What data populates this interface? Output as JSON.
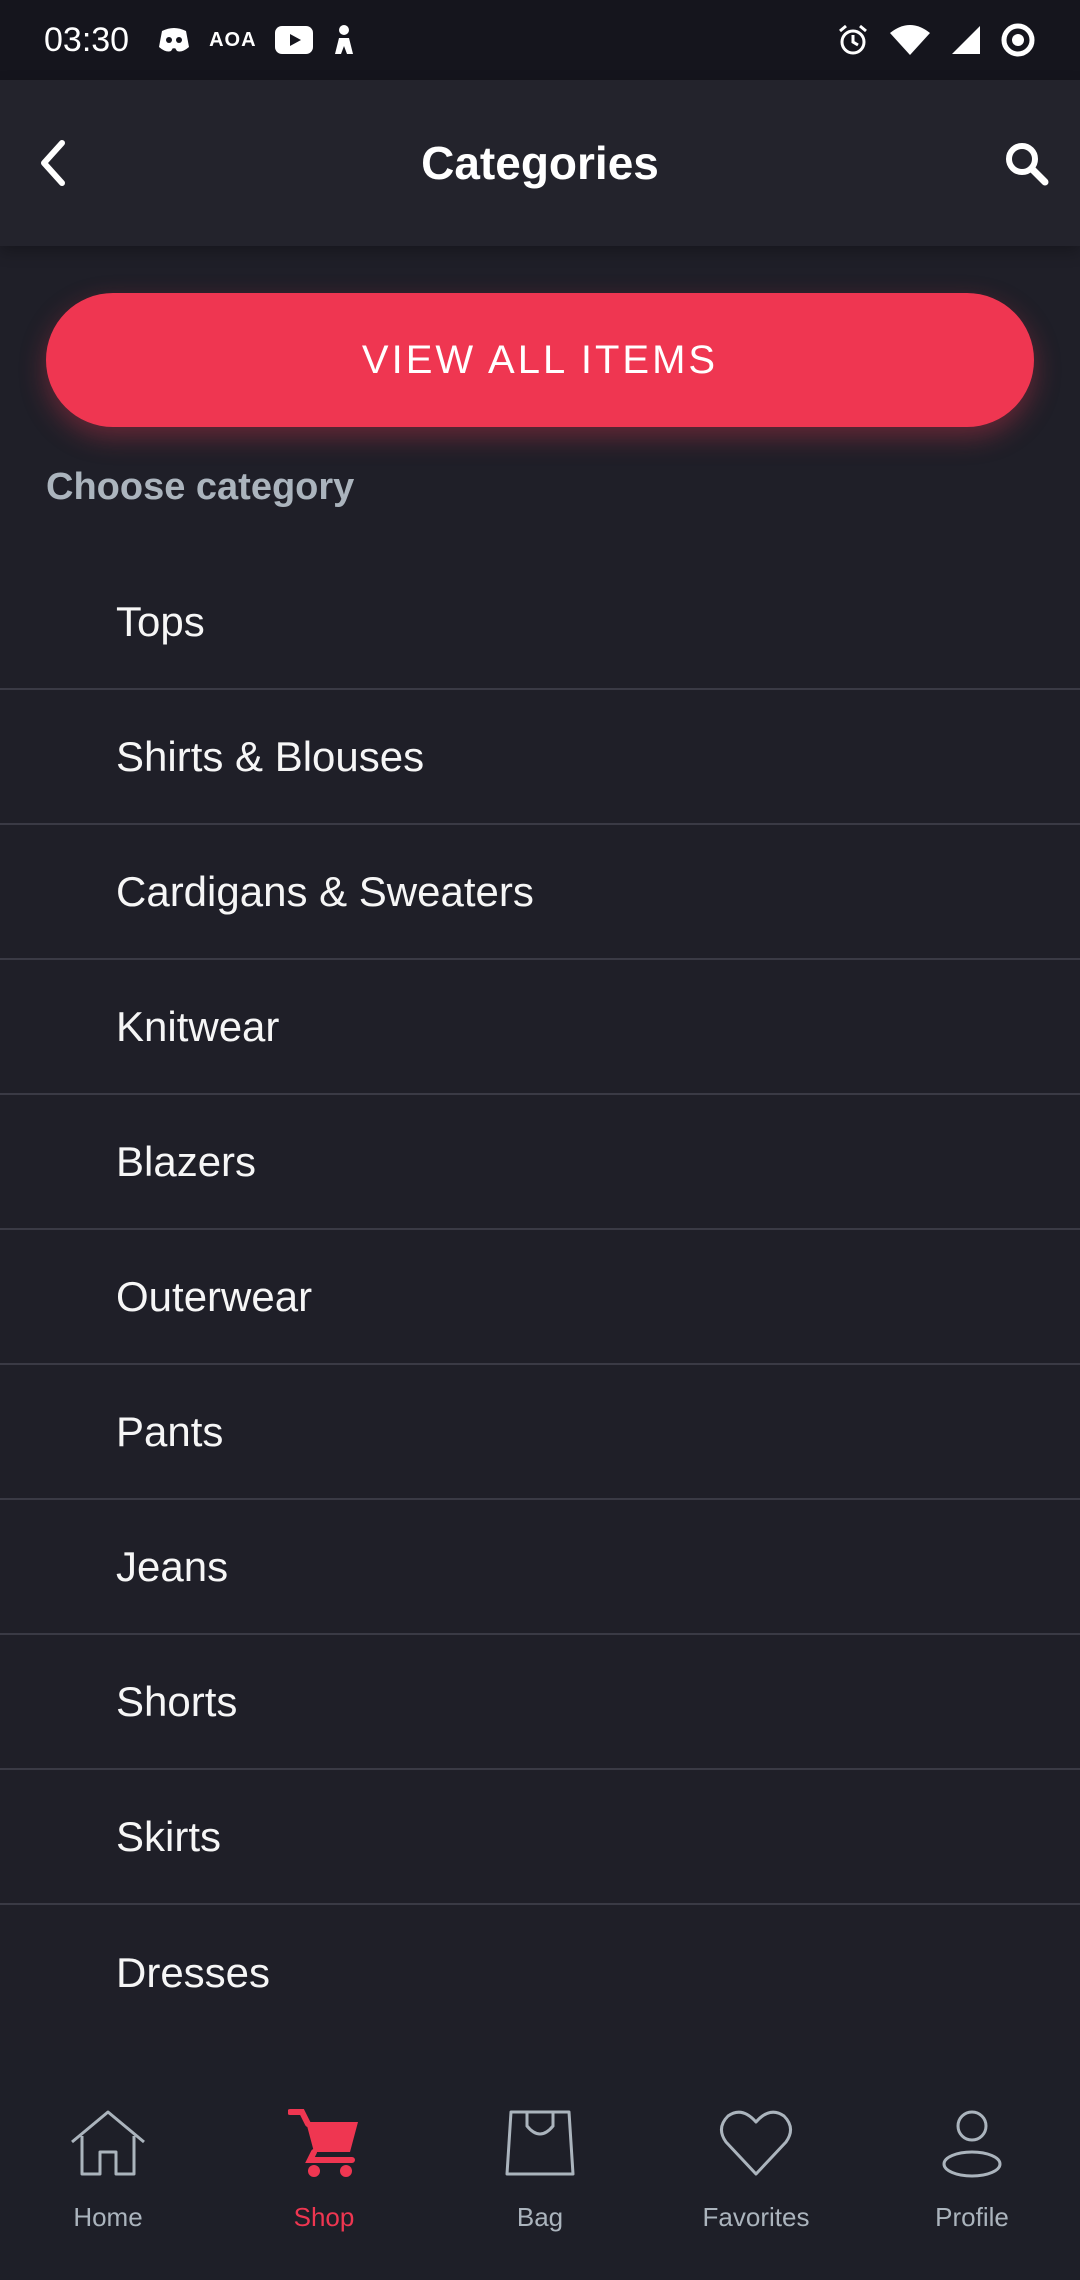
{
  "status_bar": {
    "time": "03:30",
    "aoa_label": "AOA",
    "icons": [
      "discord-icon",
      "youtube-icon",
      "notification-figure-icon",
      "alarm-icon",
      "wifi-icon",
      "signal-icon",
      "sync-ring-icon"
    ]
  },
  "header": {
    "title": "Categories",
    "back_icon": "chevron-left-icon",
    "search_icon": "search-icon"
  },
  "view_all": {
    "label": "VIEW ALL ITEMS",
    "color": "#ef3651"
  },
  "section_label": "Choose category",
  "categories": [
    "Tops",
    "Shirts & Blouses",
    "Cardigans & Sweaters",
    "Knitwear",
    "Blazers",
    "Outerwear",
    "Pants",
    "Jeans",
    "Shorts",
    "Skirts",
    "Dresses"
  ],
  "bottom_nav": {
    "active_color": "#ef3651",
    "items": [
      {
        "label": "Home",
        "icon": "home-icon",
        "active": false
      },
      {
        "label": "Shop",
        "icon": "cart-icon",
        "active": true
      },
      {
        "label": "Bag",
        "icon": "bag-icon",
        "active": false
      },
      {
        "label": "Favorites",
        "icon": "heart-icon",
        "active": false
      },
      {
        "label": "Profile",
        "icon": "profile-icon",
        "active": false
      }
    ]
  }
}
